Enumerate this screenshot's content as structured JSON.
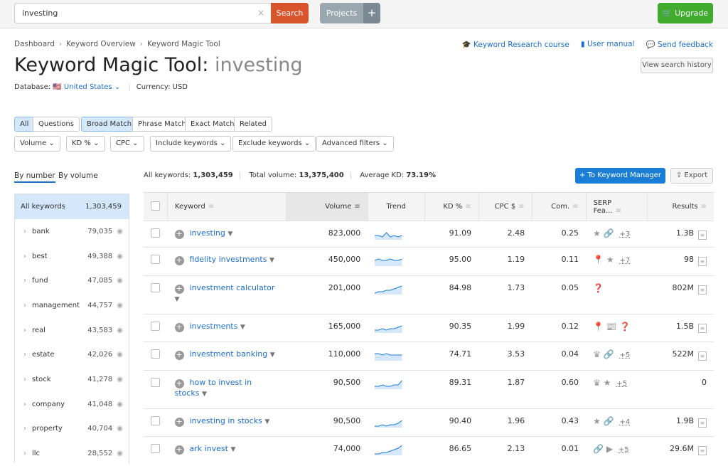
{
  "topbar": {
    "search_value": "investing",
    "clear": "×",
    "search_label": "Search",
    "projects_label": "Projects",
    "projects_add": "+",
    "upgrade_label": "Upgrade"
  },
  "breadcrumb": [
    "Dashboard",
    "Keyword Overview",
    "Keyword Magic Tool"
  ],
  "header_links": {
    "course": "Keyword Research course",
    "manual": "User manual",
    "feedback": "Send feedback"
  },
  "title": {
    "tool": "Keyword Magic Tool:",
    "keyword": "investing"
  },
  "view_history": "View search history",
  "database": {
    "label": "Database:",
    "value": "United States",
    "currency": "Currency: USD"
  },
  "tabs_type": [
    "All",
    "Questions"
  ],
  "tabs_match": [
    "Broad Match",
    "Phrase Match",
    "Exact Match",
    "Related"
  ],
  "filters": [
    "Volume",
    "KD %",
    "CPC",
    "Include keywords",
    "Exclude keywords",
    "Advanced filters"
  ],
  "group_tabs": [
    "By number",
    "By volume"
  ],
  "sidebar": {
    "all_label": "All keywords",
    "all_count": "1,303,459",
    "items": [
      {
        "name": "bank",
        "count": "79,035"
      },
      {
        "name": "best",
        "count": "49,388"
      },
      {
        "name": "fund",
        "count": "47,085"
      },
      {
        "name": "management",
        "count": "44,757"
      },
      {
        "name": "real",
        "count": "43,583"
      },
      {
        "name": "estate",
        "count": "42,026"
      },
      {
        "name": "stock",
        "count": "41,278"
      },
      {
        "name": "company",
        "count": "41,048"
      },
      {
        "name": "property",
        "count": "40,704"
      },
      {
        "name": "llc",
        "count": "28,552"
      }
    ]
  },
  "stats": {
    "all_label": "All keywords:",
    "all_value": "1,303,459",
    "vol_label": "Total volume:",
    "vol_value": "13,375,400",
    "kd_label": "Average KD:",
    "kd_value": "73.19%"
  },
  "actions": {
    "to_manager": "To Keyword Manager",
    "export": "Export"
  },
  "table": {
    "headers": [
      "Keyword",
      "Volume",
      "Trend",
      "KD %",
      "CPC $",
      "Com.",
      "SERP Fea...",
      "Results"
    ],
    "rows": [
      {
        "keyword": "investing",
        "volume": "823,000",
        "kd": "91.09",
        "cpc": "2.48",
        "com": "0.25",
        "serp": [
          "star",
          "link"
        ],
        "more": "+3",
        "results": "1.3B",
        "tall": false
      },
      {
        "keyword": "fidelity investments",
        "volume": "450,000",
        "kd": "95.00",
        "cpc": "1.19",
        "com": "0.11",
        "serp": [
          "pin",
          "star"
        ],
        "more": "+7",
        "results": "98",
        "tall": false
      },
      {
        "keyword": "investment calculator",
        "volume": "201,000",
        "kd": "84.98",
        "cpc": "1.73",
        "com": "0.05",
        "serp": [
          "faq"
        ],
        "more": "",
        "results": "802M",
        "tall": true
      },
      {
        "keyword": "investments",
        "volume": "165,000",
        "kd": "90.35",
        "cpc": "1.99",
        "com": "0.12",
        "serp": [
          "pin",
          "news",
          "faq"
        ],
        "more": "",
        "results": "1.5B",
        "tall": false
      },
      {
        "keyword": "investment banking",
        "volume": "110,000",
        "kd": "74.71",
        "cpc": "3.53",
        "com": "0.04",
        "serp": [
          "crown",
          "link"
        ],
        "more": "+5",
        "results": "522M",
        "tall": false
      },
      {
        "keyword": "how to invest in stocks",
        "volume": "90,500",
        "kd": "89.31",
        "cpc": "1.87",
        "com": "0.60",
        "serp": [
          "crown",
          "star"
        ],
        "more": "+5",
        "results": "0",
        "tall": true
      },
      {
        "keyword": "investing in stocks",
        "volume": "90,500",
        "kd": "90.40",
        "cpc": "1.96",
        "com": "0.43",
        "serp": [
          "star",
          "link"
        ],
        "more": "+4",
        "results": "1.9B",
        "tall": false
      },
      {
        "keyword": "ark invest",
        "volume": "74,000",
        "kd": "86.65",
        "cpc": "2.13",
        "com": "0.01",
        "serp": [
          "link",
          "video"
        ],
        "more": "+5",
        "results": "29.6M",
        "tall": false
      }
    ]
  },
  "colors": {
    "accent": "#1b6fd1",
    "search": "#d9542a",
    "upgrade": "#3fac2e",
    "selected": "#d4e7fb"
  }
}
